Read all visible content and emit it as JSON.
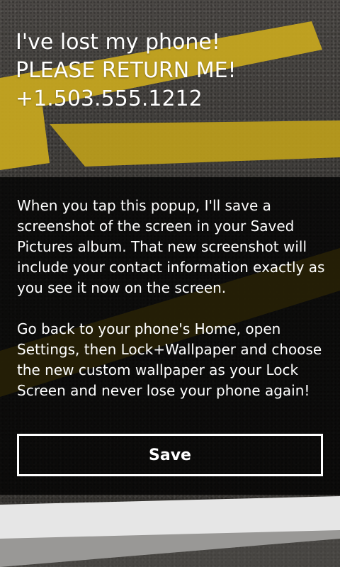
{
  "lock_screen": {
    "line1": "I've lost my phone!",
    "line2": "PLEASE RETURN ME!",
    "line3": "+1.503.555.1212"
  },
  "popup": {
    "paragraph1": "When you tap this popup, I'll save a screenshot of the screen in your Saved Pictures album. That new screenshot will include your contact information exactly as you see it now on the screen.",
    "paragraph2": "Go back to your phone's Home, open Settings, then Lock+Wallpaper and choose the new custom wallpaper as your Lock Screen and never lose your phone again!",
    "save_label": "Save"
  },
  "colors": {
    "road_line_yellow": "#c9a81e",
    "road_line_white": "#e8e8e8",
    "asphalt": "#3b3936",
    "popup_overlay": "#000000",
    "text": "#ffffff"
  }
}
